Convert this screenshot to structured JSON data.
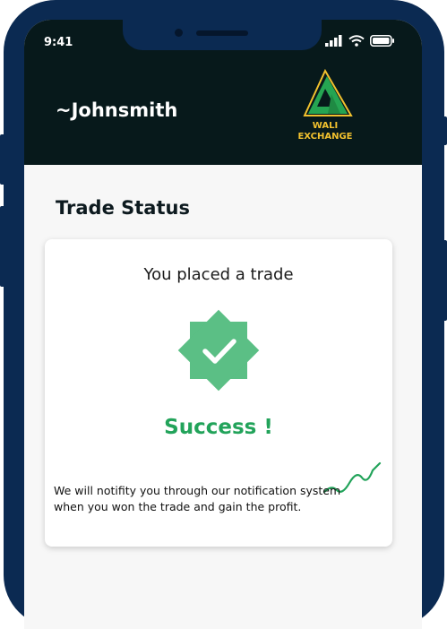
{
  "status_bar": {
    "time": "9:41",
    "icons": [
      "signal-icon",
      "wifi-icon",
      "battery-icon"
    ]
  },
  "header": {
    "username": "~Johnsmith",
    "logo": {
      "line1": "WALI",
      "line2": "EXCHANGE"
    }
  },
  "page": {
    "title": "Trade Status"
  },
  "card": {
    "heading": "You placed a trade",
    "status_icon": "check-badge-icon",
    "status_text": "Success !",
    "message": "We will notifity you through our notification system when you won the trade and gain the profit."
  },
  "colors": {
    "frame": "#0b2a52",
    "header_bg": "#07191b",
    "success_green": "#22a35a",
    "badge_green": "#5bbf85",
    "logo_gold": "#f2c12e"
  }
}
